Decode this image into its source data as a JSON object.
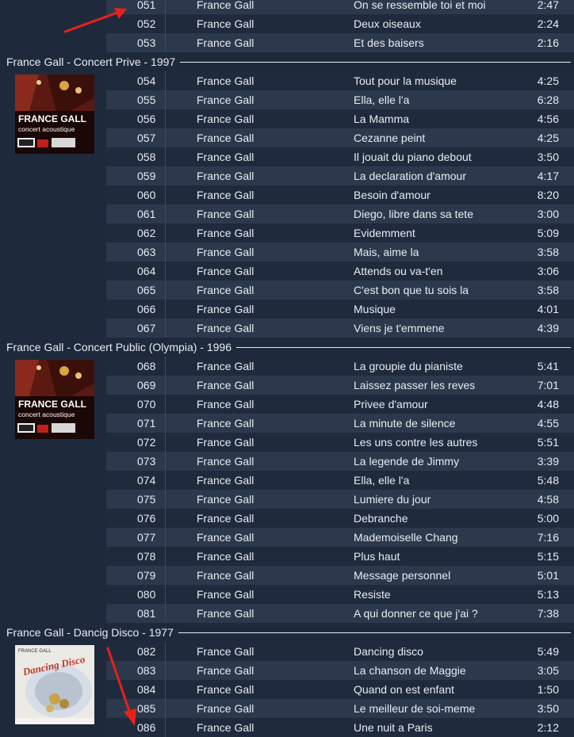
{
  "groups": [
    {
      "header": "",
      "album_art": "",
      "tracks": [
        {
          "num": "051",
          "artist": "France Gall",
          "title": "On se ressemble toi et moi",
          "duration": "2:47"
        },
        {
          "num": "052",
          "artist": "France Gall",
          "title": "Deux oiseaux",
          "duration": "2:24"
        },
        {
          "num": "053",
          "artist": "France Gall",
          "title": "Et des baisers",
          "duration": "2:16"
        }
      ]
    },
    {
      "header": "France Gall - Concert Prive - 1997",
      "album_art": "concert-album-art",
      "tracks": [
        {
          "num": "054",
          "artist": "France Gall",
          "title": "Tout pour la musique",
          "duration": "4:25"
        },
        {
          "num": "055",
          "artist": "France Gall",
          "title": "Ella, elle l'a",
          "duration": "6:28"
        },
        {
          "num": "056",
          "artist": "France Gall",
          "title": "La Mamma",
          "duration": "4:56"
        },
        {
          "num": "057",
          "artist": "France Gall",
          "title": "Cezanne peint",
          "duration": "4:25"
        },
        {
          "num": "058",
          "artist": "France Gall",
          "title": "Il jouait du piano debout",
          "duration": "3:50"
        },
        {
          "num": "059",
          "artist": "France Gall",
          "title": "La declaration d'amour",
          "duration": "4:17"
        },
        {
          "num": "060",
          "artist": "France Gall",
          "title": "Besoin d'amour",
          "duration": "8:20"
        },
        {
          "num": "061",
          "artist": "France Gall",
          "title": "Diego, libre dans sa tete",
          "duration": "3:00"
        },
        {
          "num": "062",
          "artist": "France Gall",
          "title": "Evidemment",
          "duration": "5:09"
        },
        {
          "num": "063",
          "artist": "France Gall",
          "title": "Mais, aime la",
          "duration": "3:58"
        },
        {
          "num": "064",
          "artist": "France Gall",
          "title": "Attends ou va-t'en",
          "duration": "3:06"
        },
        {
          "num": "065",
          "artist": "France Gall",
          "title": "C'est bon que tu sois la",
          "duration": "3:58"
        },
        {
          "num": "066",
          "artist": "France Gall",
          "title": "Musique",
          "duration": "4:01"
        },
        {
          "num": "067",
          "artist": "France Gall",
          "title": "Viens je t'emmene",
          "duration": "4:39"
        }
      ]
    },
    {
      "header": "France Gall - Concert Public (Olympia) - 1996",
      "album_art": "concert-album-art",
      "tracks": [
        {
          "num": "068",
          "artist": "France Gall",
          "title": "La groupie du pianiste",
          "duration": "5:41"
        },
        {
          "num": "069",
          "artist": "France Gall",
          "title": "Laissez passer les reves",
          "duration": "7:01"
        },
        {
          "num": "070",
          "artist": "France Gall",
          "title": "Privee d'amour",
          "duration": "4:48"
        },
        {
          "num": "071",
          "artist": "France Gall",
          "title": "La minute de silence",
          "duration": "4:55"
        },
        {
          "num": "072",
          "artist": "France Gall",
          "title": "Les uns contre les autres",
          "duration": "5:51"
        },
        {
          "num": "073",
          "artist": "France Gall",
          "title": "La legende de Jimmy",
          "duration": "3:39"
        },
        {
          "num": "074",
          "artist": "France Gall",
          "title": "Ella, elle l'a",
          "duration": "5:48"
        },
        {
          "num": "075",
          "artist": "France Gall",
          "title": "Lumiere du jour",
          "duration": "4:58"
        },
        {
          "num": "076",
          "artist": "France Gall",
          "title": "Debranche",
          "duration": "5:00"
        },
        {
          "num": "077",
          "artist": "France Gall",
          "title": "Mademoiselle Chang",
          "duration": "7:16"
        },
        {
          "num": "078",
          "artist": "France Gall",
          "title": "Plus haut",
          "duration": "5:15"
        },
        {
          "num": "079",
          "artist": "France Gall",
          "title": "Message personnel",
          "duration": "5:01"
        },
        {
          "num": "080",
          "artist": "France Gall",
          "title": "Resiste",
          "duration": "5:13"
        },
        {
          "num": "081",
          "artist": "France Gall",
          "title": "A qui donner ce que j'ai ?",
          "duration": "7:38"
        }
      ]
    },
    {
      "header": "France Gall - Dancig Disco - 1977",
      "album_art": "disco-album-art",
      "tracks": [
        {
          "num": "082",
          "artist": "France Gall",
          "title": "Dancing disco",
          "duration": "5:49"
        },
        {
          "num": "083",
          "artist": "France Gall",
          "title": "La chanson de Maggie",
          "duration": "3:05"
        },
        {
          "num": "084",
          "artist": "France Gall",
          "title": "Quand on est enfant",
          "duration": "1:50"
        },
        {
          "num": "085",
          "artist": "France Gall",
          "title": "Le meilleur de soi-meme",
          "duration": "3:50"
        },
        {
          "num": "086",
          "artist": "France Gall",
          "title": "Une nuit a Paris",
          "duration": "2:12"
        }
      ]
    }
  ],
  "album_art_text": {
    "concert_line1": "FRANCE GALL",
    "concert_line2": "concert acoustique",
    "disco_artist": "FRANCE GALL",
    "disco_title": "Dancing Disco"
  },
  "colors": {
    "background": "#1e2a3c",
    "row_odd": "#2c394c",
    "row_even": "#1f2b3d",
    "text": "#e6ecf4",
    "annotation_arrow": "#e8201c"
  },
  "annotation_icons": [
    "red-arrow-icon",
    "red-arrow-icon"
  ]
}
